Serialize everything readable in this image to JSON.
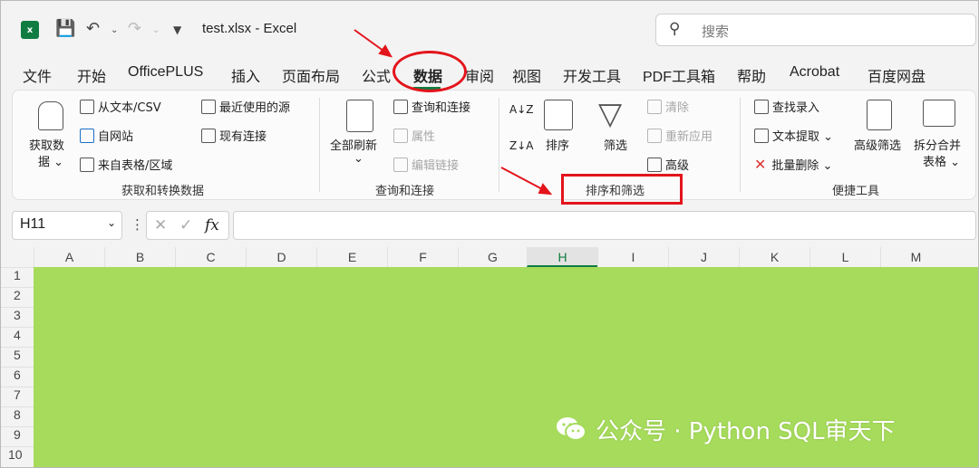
{
  "titlebar": {
    "logo_letter": "x",
    "window_title": "test.xlsx  -  Excel",
    "search_placeholder": "搜索"
  },
  "tabs": [
    "文件",
    "开始",
    "OfficePLUS",
    "插入",
    "页面布局",
    "公式",
    "数据",
    "审阅",
    "视图",
    "开发工具",
    "PDF工具箱",
    "帮助",
    "Acrobat",
    "百度网盘"
  ],
  "active_tab": "数据",
  "ribbon": {
    "get_data": {
      "big_button": "获取数",
      "big_button_2": "据",
      "from_text": "从文本/CSV",
      "from_web": "自网站",
      "from_table": "来自表格/区域",
      "recent_sources": "最近使用的源",
      "existing_connections": "现有连接",
      "group_label": "获取和转换数据"
    },
    "queries": {
      "refresh_all": "全部刷新",
      "queries_connections": "查询和连接",
      "properties": "属性",
      "edit_links": "编辑链接",
      "group_label": "查询和连接"
    },
    "sort_filter": {
      "sort_az": "A↓Z",
      "sort_za": "Z↓A",
      "sort": "排序",
      "filter": "筛选",
      "clear": "清除",
      "reapply": "重新应用",
      "advanced": "高级",
      "group_label": "排序和筛选"
    },
    "quick_tools": {
      "find_entry": "查找录入",
      "text_extract": "文本提取",
      "batch_delete": "批量删除",
      "advanced_filter": "高级筛选",
      "split_merge": "拆分合并",
      "split_merge_2": "表格",
      "group_label": "便捷工具"
    }
  },
  "formula_bar": {
    "name_box": "H11",
    "fx": "fx"
  },
  "grid": {
    "columns": [
      "A",
      "B",
      "C",
      "D",
      "E",
      "F",
      "G",
      "H",
      "I",
      "J",
      "K",
      "L",
      "M"
    ],
    "selected_column": "H",
    "rows": [
      "1",
      "2",
      "3",
      "4",
      "5",
      "6",
      "7",
      "8",
      "9",
      "10"
    ],
    "fill_color": "#a6db5b"
  },
  "annotations": {
    "color": "#e3141b"
  },
  "watermark": {
    "text": "公众号 · Python SQL审天下"
  }
}
